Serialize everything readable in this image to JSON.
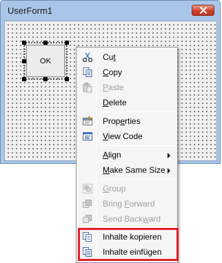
{
  "window": {
    "title": "UserForm1",
    "close_icon": "close-icon"
  },
  "form": {
    "ok_button_label": "OK"
  },
  "context_menu": {
    "items": [
      {
        "pre": "Cu",
        "acc": "t",
        "post": "",
        "icon": "scissors-icon",
        "disabled": false
      },
      {
        "pre": "",
        "acc": "C",
        "post": "opy",
        "icon": "copy-icon",
        "disabled": false
      },
      {
        "pre": "",
        "acc": "P",
        "post": "aste",
        "icon": "paste-icon",
        "disabled": true
      },
      {
        "pre": "",
        "acc": "D",
        "post": "elete",
        "icon": "",
        "disabled": false
      },
      {
        "pre": "Prop",
        "acc": "e",
        "post": "rties",
        "icon": "properties-icon",
        "disabled": false
      },
      {
        "pre": "",
        "acc": "V",
        "post": "iew Code",
        "icon": "view-code-icon",
        "disabled": false
      },
      {
        "pre": "",
        "acc": "A",
        "post": "lign",
        "icon": "",
        "disabled": false,
        "submenu": true
      },
      {
        "pre": "",
        "acc": "M",
        "post": "ake Same Size",
        "icon": "",
        "disabled": false,
        "submenu": true
      },
      {
        "pre": "",
        "acc": "G",
        "post": "roup",
        "icon": "group-icon",
        "disabled": true
      },
      {
        "pre": "Bring ",
        "acc": "F",
        "post": "orward",
        "icon": "bring-forward-icon",
        "disabled": true
      },
      {
        "pre": "Send Back",
        "acc": "w",
        "post": "ard",
        "icon": "send-backward-icon",
        "disabled": true
      },
      {
        "pre": "",
        "acc": "",
        "post": "Inhalte kopieren",
        "icon": "copy-content-icon",
        "disabled": false
      },
      {
        "pre": "",
        "acc": "",
        "post": "Inhalte einfügen",
        "icon": "paste-content-icon",
        "disabled": false
      }
    ]
  },
  "colors": {
    "highlight": "#e31e24",
    "window_frame": "#a9c6e8",
    "close_button": "#c9402d"
  }
}
